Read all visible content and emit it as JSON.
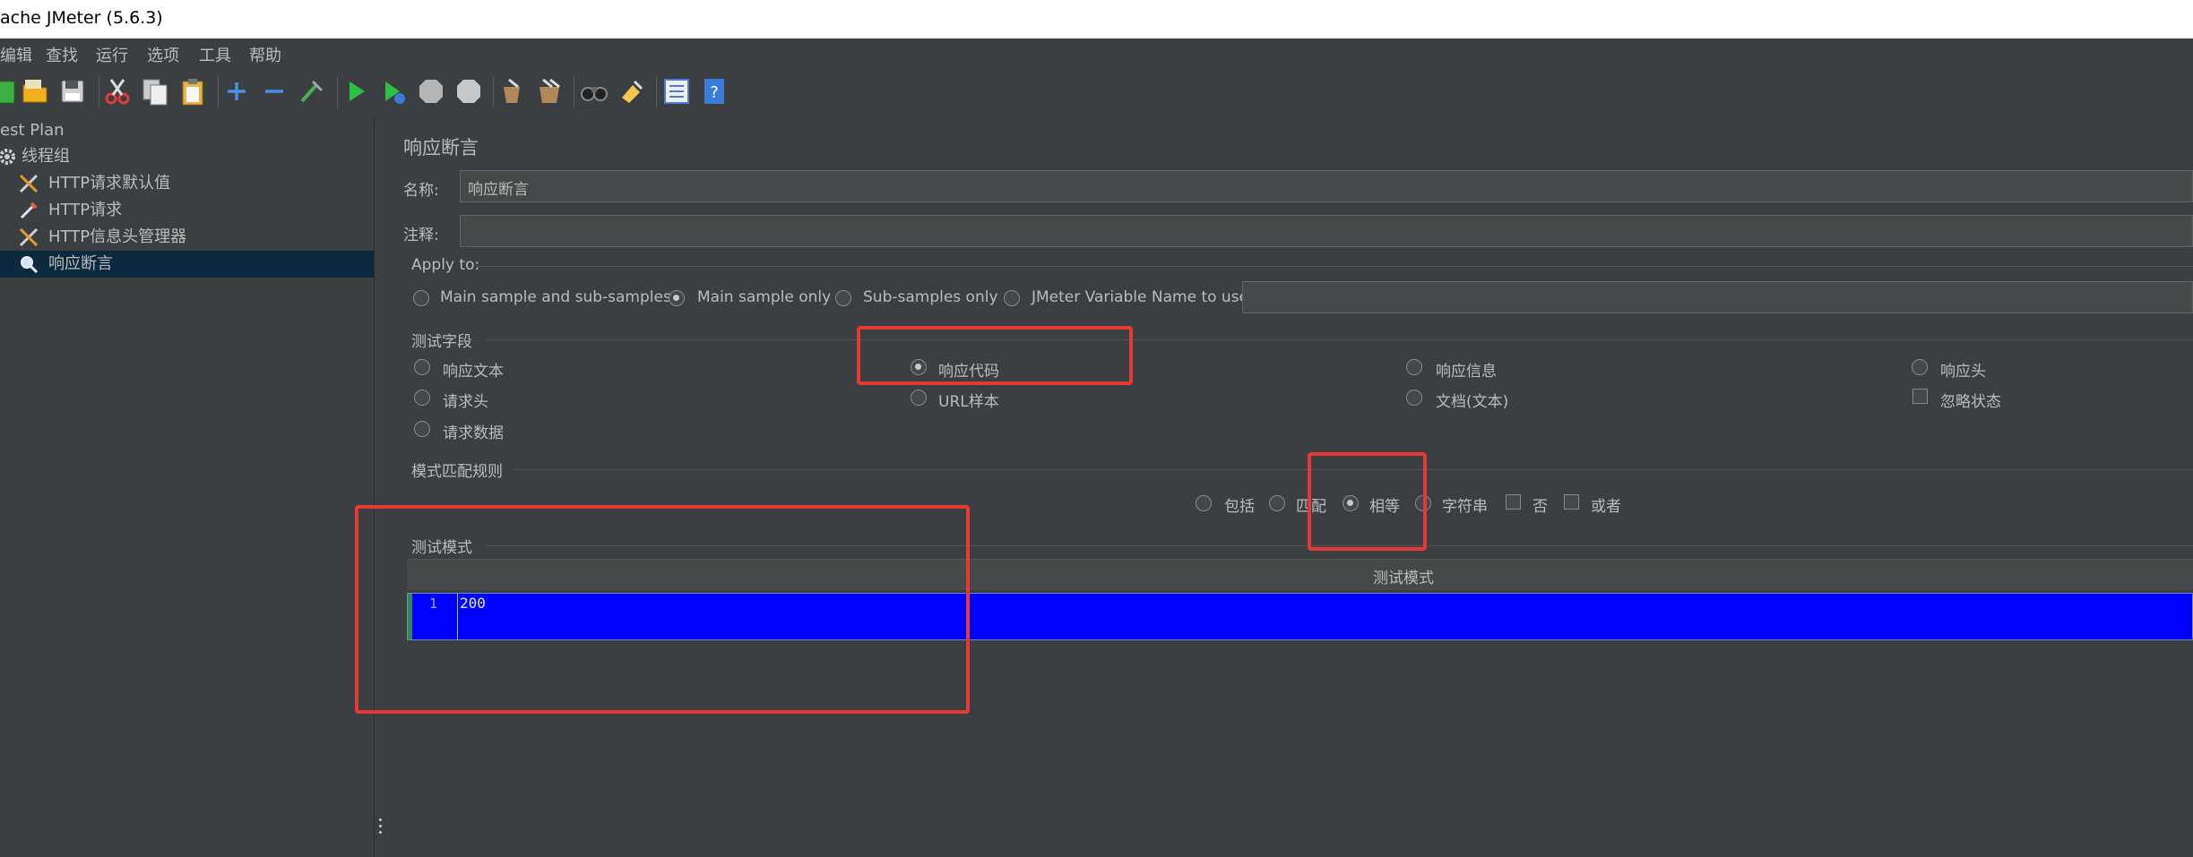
{
  "window": {
    "title": "ache JMeter (5.6.3)"
  },
  "menu": {
    "items": [
      "编辑",
      "查找",
      "运行",
      "选项",
      "工具",
      "帮助"
    ]
  },
  "toolbar": {
    "buttons": [
      "new-icon",
      "open-icon",
      "save-icon",
      "cut-icon",
      "copy-icon",
      "paste-icon",
      "expand-icon",
      "collapse-icon",
      "toggle-icon",
      "start-icon",
      "start-no-pause-icon",
      "stop-icon",
      "shutdown-icon",
      "clear-icon",
      "clear-all-icon",
      "search-icon",
      "reset-search-icon",
      "function-helper-icon",
      "help-icon"
    ]
  },
  "tree": {
    "items": [
      {
        "label": "est Plan"
      },
      {
        "label": "线程组"
      },
      {
        "label": "HTTP请求默认值"
      },
      {
        "label": "HTTP请求"
      },
      {
        "label": "HTTP信息头管理器"
      },
      {
        "label": "响应断言"
      }
    ]
  },
  "panel": {
    "title": "响应断言",
    "name_label": "名称:",
    "name_value": "响应断言",
    "comment_label": "注释:",
    "comment_value": "",
    "apply_to": {
      "label": "Apply to:",
      "options": [
        "Main sample and sub-samples",
        "Main sample only",
        "Sub-samples only",
        "JMeter Variable Name to use"
      ],
      "selected": "Main sample only",
      "variable_value": ""
    },
    "test_field": {
      "label": "测试字段",
      "options": [
        "响应文本",
        "响应代码",
        "响应信息",
        "响应头",
        "请求头",
        "URL样本",
        "文档(文本)",
        "请求数据"
      ],
      "selected": "响应代码",
      "ignore_status_label": "忽略状态",
      "ignore_status_checked": false
    },
    "pattern_rules": {
      "label": "模式匹配规则",
      "options": [
        "包括",
        "匹配",
        "相等",
        "字符串"
      ],
      "selected": "相等",
      "not_label": "否",
      "or_label": "或者"
    },
    "patterns": {
      "label": "测试模式",
      "column_header": "测试模式",
      "lines": [
        {
          "num": "1",
          "text": "200"
        }
      ]
    }
  },
  "colors": {
    "annotation_red": "#e53935",
    "selection_blue": "#0000ff",
    "background": "#3c3f41"
  }
}
